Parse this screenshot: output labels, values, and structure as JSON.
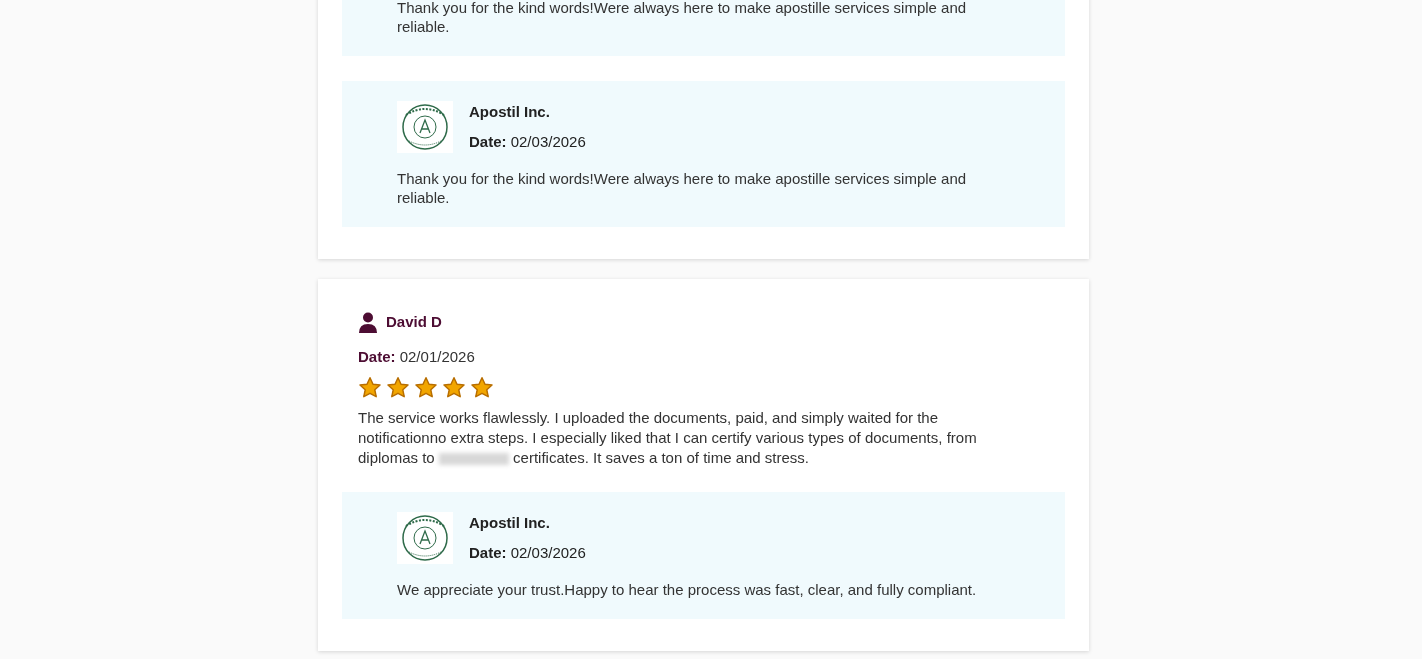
{
  "reviews": [
    {
      "replies": [
        {
          "text": "Thank you for the kind words!Were always here to make apostille services simple and reliable."
        },
        {
          "author": "Apostil Inc.",
          "date_label": "Date:",
          "date": "02/03/2026",
          "text": "Thank you for the kind words!Were always here to make apostille services simple and reliable."
        }
      ]
    },
    {
      "author": "David D",
      "date_label": "Date:",
      "date": "02/01/2026",
      "stars": 5,
      "text": [
        "The service works flawlessly. I uploaded the documents, paid, and simply waited for the notificationno extra steps. I especially liked that I can certify various types of documents, from diplomas to",
        "certificates. It saves a ton of time and stress."
      ],
      "replies": [
        {
          "author": "Apostil Inc.",
          "date_label": "Date:",
          "date": "02/03/2026",
          "text": "We appreciate your trust.Happy to hear the process was fast, clear, and fully compliant."
        }
      ]
    }
  ]
}
